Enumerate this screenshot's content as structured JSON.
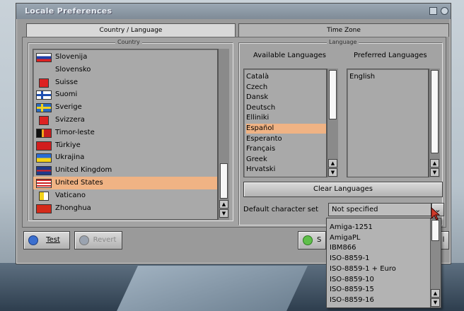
{
  "window": {
    "title": "Locale Preferences"
  },
  "tabs": [
    {
      "label": "Country / Language",
      "active": true
    },
    {
      "label": "Time Zone",
      "active": false
    }
  ],
  "country_group": {
    "label": "Country",
    "items": [
      {
        "label": "Slovenija",
        "flag": "slovenia-flag"
      },
      {
        "label": "Slovensko",
        "flag": ""
      },
      {
        "label": "Suisse",
        "flag": "switzerland-flag"
      },
      {
        "label": "Suomi",
        "flag": "finland-flag"
      },
      {
        "label": "Sverige",
        "flag": "sweden-flag"
      },
      {
        "label": "Svizzera",
        "flag": "switzerland-flag"
      },
      {
        "label": "Timor-leste",
        "flag": "timor-leste-flag"
      },
      {
        "label": "Türkiye",
        "flag": "turkey-flag"
      },
      {
        "label": "Ukrajina",
        "flag": "ukraine-flag"
      },
      {
        "label": "United Kingdom",
        "flag": "uk-flag"
      },
      {
        "label": "United States",
        "flag": "us-flag",
        "selected": true
      },
      {
        "label": "Vaticano",
        "flag": "vatican-flag"
      },
      {
        "label": "Zhonghua",
        "flag": "china-flag"
      }
    ]
  },
  "language_group": {
    "label": "Language",
    "available_header": "Available Languages",
    "preferred_header": "Preferred Languages",
    "available": [
      "Català",
      "Czech",
      "Dansk",
      "Deutsch",
      "Elliniki",
      "Español",
      "Esperanto",
      "Français",
      "Greek",
      "Hrvatski"
    ],
    "available_selected": "Español",
    "preferred": [
      "English"
    ],
    "clear_button": "Clear Languages",
    "charset_label": "Default character set",
    "charset_value": "Not specified",
    "charset_options": [
      "Amiga-1251",
      "AmigaPL",
      "IBM866",
      "ISO-8859-1",
      "ISO-8859-1 + Euro",
      "ISO-8859-10",
      "ISO-8859-15",
      "ISO-8859-16"
    ]
  },
  "buttons": {
    "test": "Test",
    "revert": "Revert",
    "save_partial": "S",
    "close_partial": "l"
  },
  "colors": {
    "selection": "#f0b384",
    "window_bg": "#9a9a9a",
    "titlebar": "#8894a0"
  }
}
